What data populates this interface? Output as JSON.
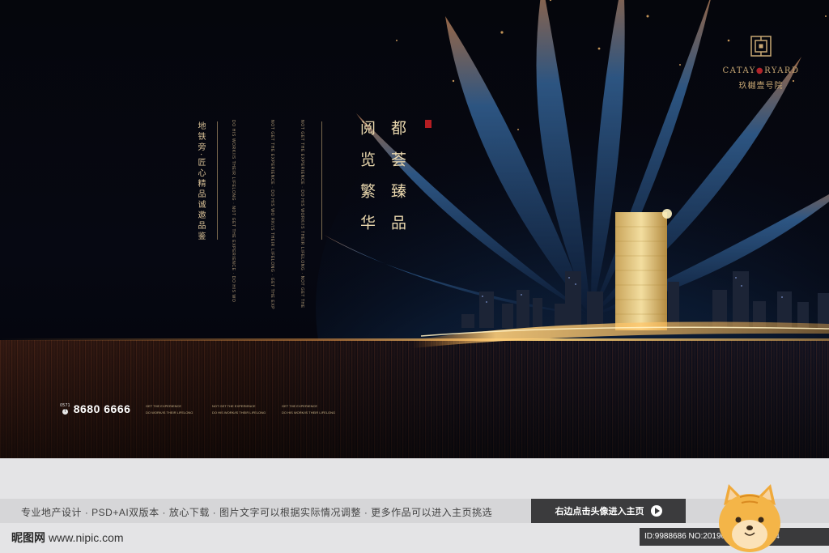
{
  "logo": {
    "name_en_left": "CATAY",
    "name_en_right": "RYARD",
    "name_cn": "玖樾壹号院"
  },
  "headline": {
    "col1": "都荟臻品",
    "col2": "阅览繁华",
    "slogan": "地铁旁·匠心精品诚邀品鉴"
  },
  "english": {
    "col1": "DO HIS WORK/IS THEIR LIFELONG · NOT GET THE EXPERIENCE · DO HIS WO",
    "col2": "NOT GET THE EXPERIENCE · DO HIS WO RK/IS THEIR LIFELONG · GET THE EXP",
    "col3": "NOT GET THE EXPERIENCE · DO HIS WORK/IS THEIR LIFELONG · NOT GET THE"
  },
  "contact": {
    "area_code": "0571",
    "phone": "8680 6666"
  },
  "tags": [
    {
      "line1": "GET THE EXPERIENCE",
      "line2": "DO WORK/IS THEIR LIFELONG"
    },
    {
      "line1": "NOT GET THE EXPERIENCE",
      "line2": "DO HIS WORK/IS THEIR LIFELONG"
    },
    {
      "line1": "GET THE EXPERIENCE",
      "line2": "DO HIS WORK/IS THEIR LIFELONG"
    }
  ],
  "footer": {
    "description": "专业地产设计 · PSD+AI双版本 · 放心下载 · 图片文字可以根据实际情况调整 · 更多作品可以进入主页挑选",
    "button_label": "右边点击头像进入主页",
    "site_name": "昵图网",
    "site_url": "www.nipic.com",
    "id_text": "ID:9988686 NO:20190830104693084"
  },
  "colors": {
    "gold": "#e9d7ad",
    "seal_red": "#b51d22",
    "footer_bg": "#e4e4e6",
    "button_bg": "#3b3b3d"
  }
}
